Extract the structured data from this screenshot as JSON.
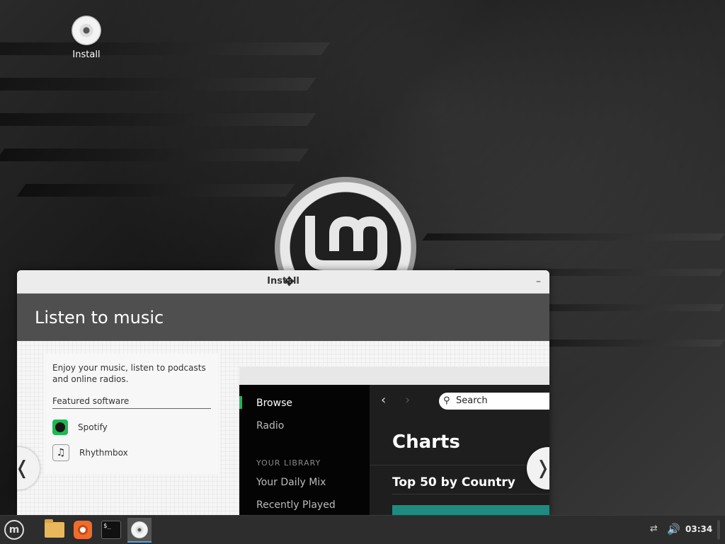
{
  "desktop": {
    "icon_label": "Install"
  },
  "window": {
    "title": "Install",
    "minimize_glyph": "–",
    "slide": {
      "heading": "Listen to music",
      "intro": "Enjoy your music, listen to podcasts and online radios.",
      "featured_label": "Featured software",
      "apps": [
        {
          "name": "Spotify",
          "icon": "spotify-icon"
        },
        {
          "name": "Rhythmbox",
          "icon": "rhythmbox-icon"
        }
      ],
      "spotify": {
        "sidebar_items": [
          "Browse",
          "Radio"
        ],
        "library_heading": "YOUR LIBRARY",
        "library_items": [
          "Your Daily Mix",
          "Recently Played"
        ],
        "search_placeholder": "Search",
        "charts_heading": "Charts",
        "top50_heading": "Top 50 by Country",
        "accent": "#1db954"
      },
      "prev_glyph": "❬",
      "next_glyph": "❭"
    }
  },
  "taskbar": {
    "clock": "03:34",
    "apps": [
      "menu-icon",
      "files-icon",
      "firefox-icon",
      "terminal-icon",
      "installer-icon"
    ],
    "terminal_text": "$_"
  }
}
